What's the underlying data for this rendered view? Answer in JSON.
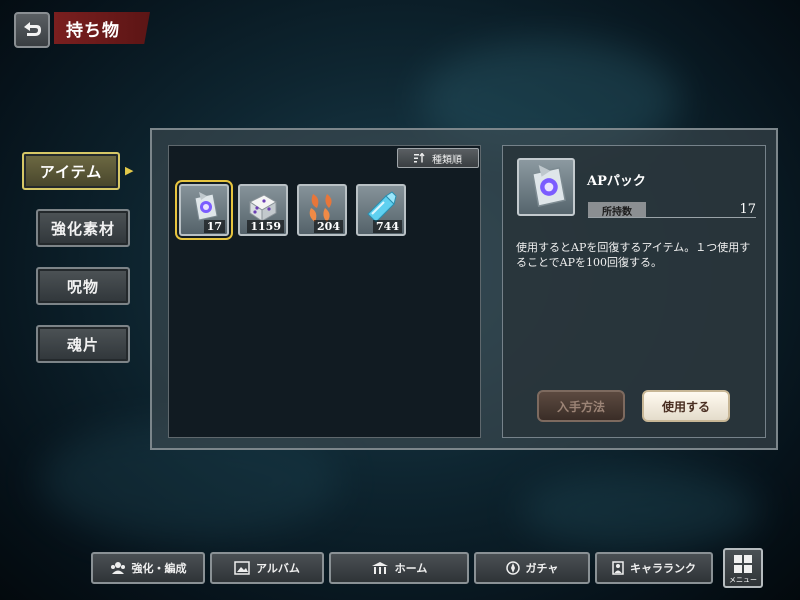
{
  "header": {
    "title": "持ち物"
  },
  "tabs": [
    {
      "label": "アイテム",
      "active": true
    },
    {
      "label": "強化素材",
      "active": false
    },
    {
      "label": "呪物",
      "active": false
    },
    {
      "label": "魂片",
      "active": false
    }
  ],
  "sort": {
    "label": "種類順"
  },
  "items": [
    {
      "icon": "ap-pack-icon",
      "count": "17",
      "selected": true
    },
    {
      "icon": "dice-icon",
      "count": "1159",
      "selected": false
    },
    {
      "icon": "petals-icon",
      "count": "204",
      "selected": false
    },
    {
      "icon": "crystal-icon",
      "count": "744",
      "selected": false
    }
  ],
  "detail": {
    "name": "APパック",
    "owned_label": "所持数",
    "owned_value": "17",
    "description": "使用するとAPを回復するアイテム。１つ使用することでAPを100回復する。",
    "acquire_label": "入手方法",
    "use_label": "使用する"
  },
  "nav": [
    {
      "label": "強化・編成",
      "icon": "party-icon"
    },
    {
      "label": "アルバム",
      "icon": "album-icon"
    },
    {
      "label": "ホーム",
      "icon": "home-icon"
    },
    {
      "label": "ガチャ",
      "icon": "gacha-icon"
    },
    {
      "label": "キャラランク",
      "icon": "character-rank-icon"
    }
  ],
  "menu": {
    "label": "メニュー"
  },
  "colors": {
    "accent_gold": "#e6c43f",
    "title_red": "#7a1f1f"
  }
}
